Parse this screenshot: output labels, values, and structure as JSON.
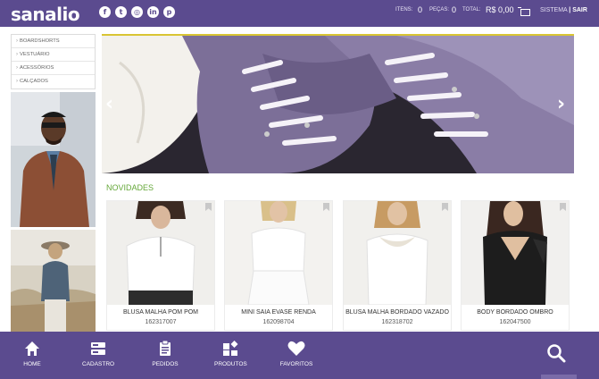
{
  "header": {
    "logo": "sanalio",
    "social_icons": [
      "facebook-icon",
      "twitter-icon",
      "instagram-icon",
      "linkedin-icon",
      "pinterest-icon"
    ],
    "social_glyphs": [
      "f",
      "t",
      "◎",
      "in",
      "p"
    ],
    "itens_label": "ITENS:",
    "itens_value": "0",
    "pecas_label": "PEÇAS:",
    "pecas_value": "0",
    "total_label": "TOTAL:",
    "total_value": "R$ 0,00",
    "account_label": "SISTEMA",
    "logout_label": "| SAIR"
  },
  "sidebar": {
    "items": [
      {
        "label": "BOARDSHORTS"
      },
      {
        "label": "VESTUÁRIO"
      },
      {
        "label": "ACESSÓRIOS"
      },
      {
        "label": "CALÇADOS"
      }
    ]
  },
  "main": {
    "section_title": "NOVIDADES",
    "products": [
      {
        "name": "BLUSA MALHA POM POM",
        "code": "162317007"
      },
      {
        "name": "MINI SAIA EVASE RENDA",
        "code": "162098704"
      },
      {
        "name": "BLUSA MALHA BORDADO VAZADO",
        "code": "162318702"
      },
      {
        "name": "BODY BORDADO OMBRO",
        "code": "162047500"
      }
    ]
  },
  "bottom_nav": {
    "items": [
      {
        "label": "HOME",
        "icon": "home-icon"
      },
      {
        "label": "CADASTRO",
        "icon": "form-icon"
      },
      {
        "label": "PEDIDOS",
        "icon": "clipboard-icon"
      },
      {
        "label": "PRODUTOS",
        "icon": "products-icon"
      },
      {
        "label": "FAVORITOS",
        "icon": "heart-icon"
      }
    ],
    "search_icon": "search-icon"
  },
  "colors": {
    "brand": "#5b4b8f",
    "accent_green": "#66a83a",
    "banner_stripe": "#d9c533"
  }
}
